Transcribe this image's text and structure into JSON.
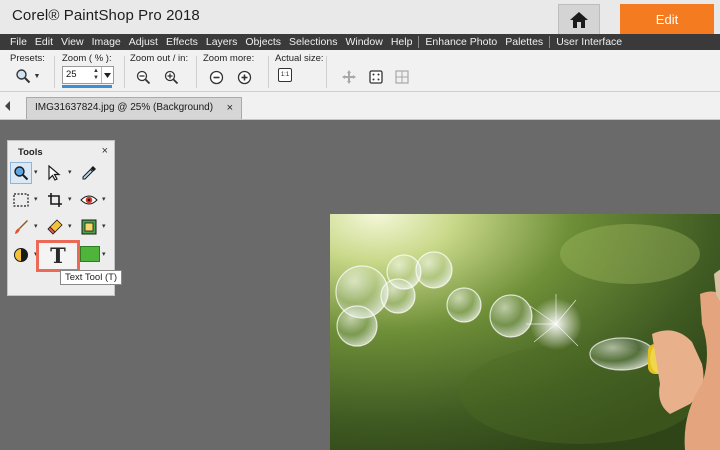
{
  "app": {
    "title": "Corel® PaintShop Pro 2018",
    "edit_tab_label": "Edit",
    "accent_color": "#f47b20"
  },
  "menu": {
    "items": [
      "File",
      "Edit",
      "View",
      "Image",
      "Adjust",
      "Effects",
      "Layers",
      "Objects",
      "Selections",
      "Window",
      "Help",
      "Enhance Photo",
      "Palettes",
      "User Interface"
    ]
  },
  "options": {
    "presets_label": "Presets:",
    "zoom_label": "Zoom ( % ):",
    "zoom_value": "25",
    "zoom_out_in_label": "Zoom out / in:",
    "zoom_more_label": "Zoom more:",
    "actual_size_label": "Actual size:",
    "actual_size_icon_text": "1:1"
  },
  "document": {
    "tab_label": "IMG31637824.jpg @  25% (Background)",
    "close_symbol": "×"
  },
  "tools": {
    "title": "Tools",
    "close_symbol": "×",
    "tooltip": "Text Tool (T)",
    "text_tool_glyph": "T",
    "icons": [
      "zoom-tool-icon",
      "pick-tool-icon",
      "dropper-tool-icon",
      "selection-tool-icon",
      "crop-tool-icon",
      "red-eye-tool-icon",
      "paint-brush-tool-icon",
      "eraser-tool-icon",
      "clone-tool-icon",
      "dodge-tool-icon",
      "text-tool-icon",
      "color-swatch-icon"
    ]
  }
}
